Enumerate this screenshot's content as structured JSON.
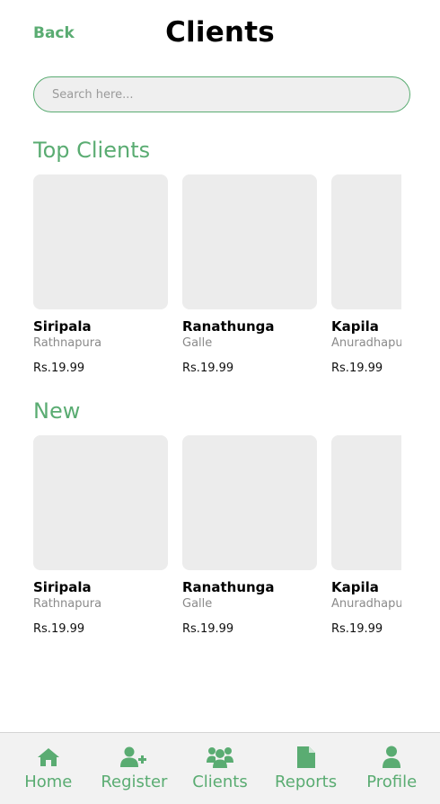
{
  "header": {
    "back_label": "Back",
    "title": "Clients"
  },
  "search": {
    "placeholder": "Search here..."
  },
  "sections": {
    "top": {
      "title": "Top Clients",
      "items": [
        {
          "name": "Siripala",
          "city": "Rathnapura",
          "price": "Rs.19.99"
        },
        {
          "name": "Ranathunga",
          "city": "Galle",
          "price": "Rs.19.99"
        },
        {
          "name": "Kapila",
          "city": "Anuradhapura",
          "price": "Rs.19.99"
        }
      ]
    },
    "new": {
      "title": "New",
      "items": [
        {
          "name": "Siripala",
          "city": "Rathnapura",
          "price": "Rs.19.99"
        },
        {
          "name": "Ranathunga",
          "city": "Galle",
          "price": "Rs.19.99"
        },
        {
          "name": "Kapila",
          "city": "Anuradhapura",
          "price": "Rs.19.99"
        }
      ]
    }
  },
  "nav": {
    "items": [
      {
        "label": "Home",
        "icon": "home-icon"
      },
      {
        "label": "Register",
        "icon": "user-plus-icon"
      },
      {
        "label": "Clients",
        "icon": "users-icon"
      },
      {
        "label": "Reports",
        "icon": "file-icon"
      },
      {
        "label": "Profile",
        "icon": "user-icon"
      }
    ]
  },
  "colors": {
    "accent": "#5aac72",
    "card_placeholder": "#ececec",
    "nav_bg": "#f2f2f2"
  }
}
